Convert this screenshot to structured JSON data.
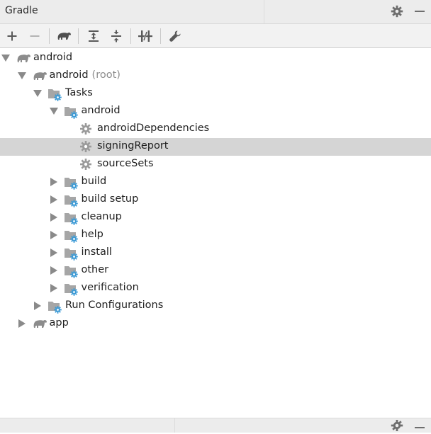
{
  "window": {
    "title": "Gradle"
  },
  "colors": {
    "selection": "#d5d5d5",
    "gradle_icon": "#8c8c8c",
    "task_gear": "#3d9bd6",
    "hint_text": "#8c8c8c"
  },
  "header_actions": [
    {
      "name": "settings-gear-icon"
    },
    {
      "name": "minimize-icon"
    }
  ],
  "toolbar": [
    {
      "name": "add-icon"
    },
    {
      "name": "remove-icon"
    },
    {
      "name": "gradle-elephant-icon"
    },
    {
      "name": "expand-all-icon"
    },
    {
      "name": "collapse-all-icon"
    },
    {
      "name": "toggle-offline-icon"
    },
    {
      "name": "wrench-icon"
    }
  ],
  "tree": [
    {
      "label": "android",
      "hint": "",
      "icon": "gradle-elephant-icon",
      "expander": "expanded",
      "depth": 0
    },
    {
      "label": "android",
      "hint": "(root)",
      "icon": "gradle-elephant-icon",
      "expander": "expanded",
      "depth": 1
    },
    {
      "label": "Tasks",
      "hint": "",
      "icon": "task-folder-icon",
      "expander": "expanded",
      "depth": 2
    },
    {
      "label": "android",
      "hint": "",
      "icon": "task-folder-icon",
      "expander": "expanded",
      "depth": 3
    },
    {
      "label": "androidDependencies",
      "hint": "",
      "icon": "gear-icon",
      "expander": "none",
      "depth": 4
    },
    {
      "label": "signingReport",
      "hint": "",
      "icon": "gear-icon",
      "expander": "none",
      "depth": 4,
      "selected": true
    },
    {
      "label": "sourceSets",
      "hint": "",
      "icon": "gear-icon",
      "expander": "none",
      "depth": 4
    },
    {
      "label": "build",
      "hint": "",
      "icon": "task-folder-icon",
      "expander": "collapsed",
      "depth": 3
    },
    {
      "label": "build setup",
      "hint": "",
      "icon": "task-folder-icon",
      "expander": "collapsed",
      "depth": 3
    },
    {
      "label": "cleanup",
      "hint": "",
      "icon": "task-folder-icon",
      "expander": "collapsed",
      "depth": 3
    },
    {
      "label": "help",
      "hint": "",
      "icon": "task-folder-icon",
      "expander": "collapsed",
      "depth": 3
    },
    {
      "label": "install",
      "hint": "",
      "icon": "task-folder-icon",
      "expander": "collapsed",
      "depth": 3
    },
    {
      "label": "other",
      "hint": "",
      "icon": "task-folder-icon",
      "expander": "collapsed",
      "depth": 3
    },
    {
      "label": "verification",
      "hint": "",
      "icon": "task-folder-icon",
      "expander": "collapsed",
      "depth": 3
    },
    {
      "label": "Run Configurations",
      "hint": "",
      "icon": "task-folder-icon",
      "expander": "collapsed",
      "depth": 2
    },
    {
      "label": "app",
      "hint": "",
      "icon": "gradle-elephant-icon",
      "expander": "collapsed",
      "depth": 1
    }
  ]
}
